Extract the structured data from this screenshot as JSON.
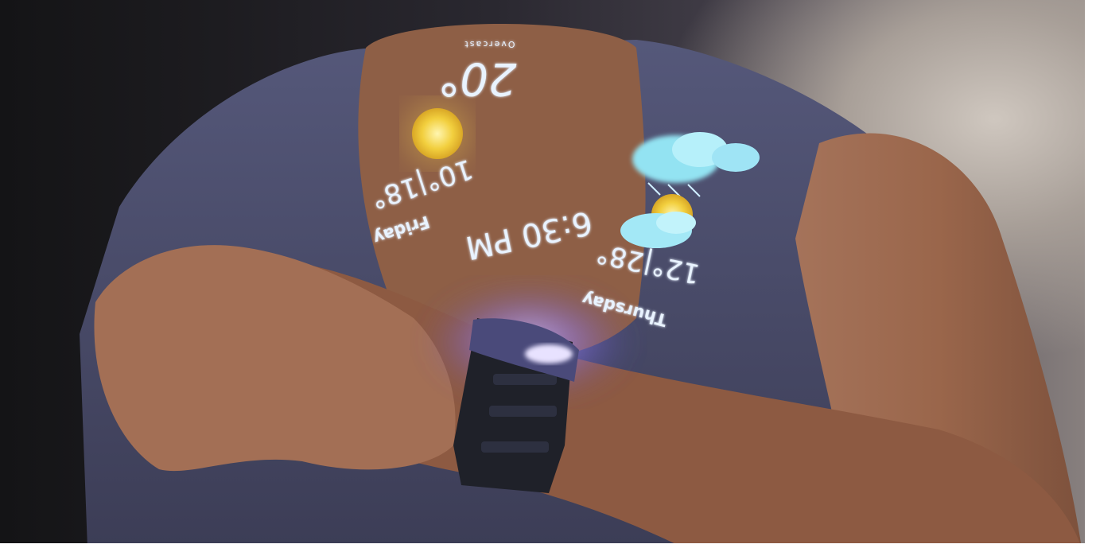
{
  "scene": {
    "description_tags": [
      "person",
      "smartwatch",
      "holographic-weather-display"
    ]
  },
  "hologram": {
    "current_temp": "20°",
    "current_condition": "Overcast",
    "time": "6:30 PM",
    "day1": {
      "label": "Friday",
      "temps": "10°|18°",
      "icon": "sun-icon"
    },
    "day2": {
      "label": "Thursday",
      "temps": "12°|28°",
      "icon": "cloud-sun-icon"
    },
    "extra_icon": "rain-cloud-icon"
  },
  "colors": {
    "shirt": "#4b4d6a",
    "skin": "#8e5c43",
    "watch": "#1f2129",
    "hologram_text": "#e9f3ff",
    "hologram_glow": "#7f6cff",
    "sun": "#f3d24a",
    "cloud": "#93e3f2"
  }
}
